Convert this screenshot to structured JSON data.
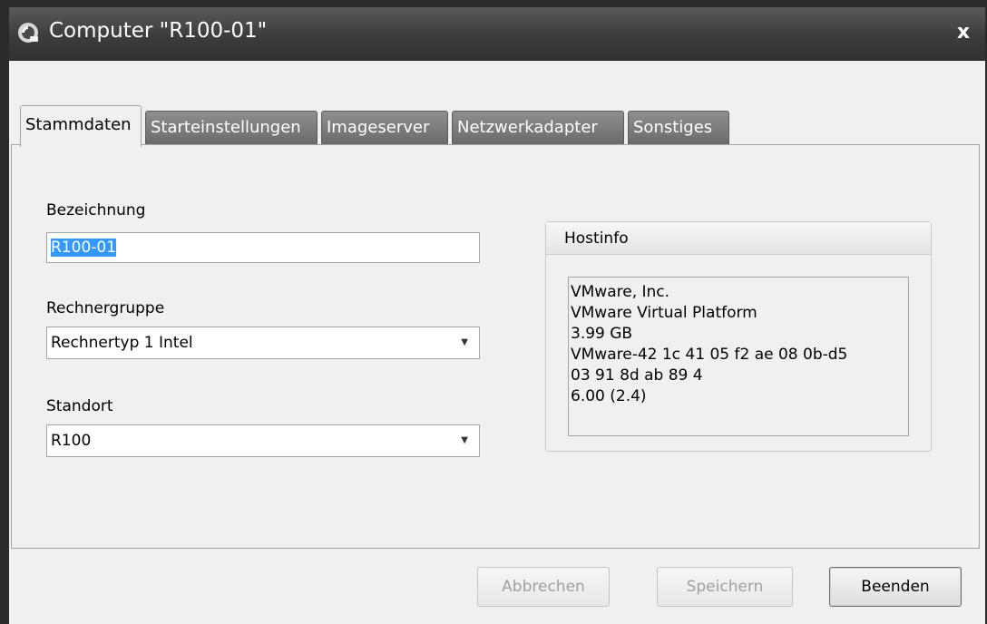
{
  "window": {
    "title": "Computer \"R100-01\"",
    "close_glyph": "x"
  },
  "tabs": [
    {
      "label": "Stammdaten",
      "active": true
    },
    {
      "label": "Starteinstellungen",
      "active": false
    },
    {
      "label": "Imageserver",
      "active": false
    },
    {
      "label": "Netzwerkadapter",
      "active": false
    },
    {
      "label": "Sonstiges",
      "active": false
    }
  ],
  "form": {
    "bezeichnung_label": "Bezeichnung",
    "bezeichnung_value": "R100-01",
    "rechnergruppe_label": "Rechnergruppe",
    "rechnergruppe_value": "Rechnertyp 1 Intel",
    "standort_label": "Standort",
    "standort_value": "R100"
  },
  "hostinfo": {
    "title": "Hostinfo",
    "lines": [
      "VMware, Inc.",
      "VMware Virtual Platform",
      "3.99 GB",
      "VMware-42 1c 41 05 f2 ae 08 0b-d5",
      "03 91 8d ab 89 4",
      "6.00 (2.4)"
    ]
  },
  "buttons": {
    "abbrechen": "Abbrechen",
    "speichern": "Speichern",
    "beenden": "Beenden"
  },
  "colors": {
    "titlebar": "#3c3c3c",
    "tab_inactive": "#7a7a7a",
    "selection": "#3399ff"
  }
}
